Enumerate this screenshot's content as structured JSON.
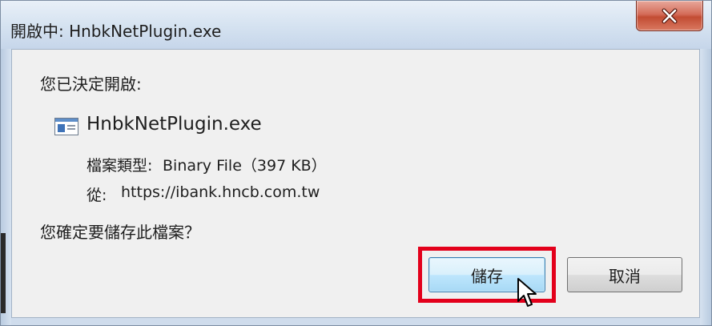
{
  "dialog": {
    "title": "開啟中: HnbkNetPlugin.exe",
    "prompt": "您已決定開啟:",
    "file": {
      "icon": "exe-file-icon",
      "name": "HnbkNetPlugin.exe",
      "type_label": "檔案類型:",
      "type_value": "Binary File（397 KB）",
      "from_label": "從:",
      "from_value": "https://ibank.hncb.com.tw"
    },
    "question": "您確定要儲存此檔案？",
    "buttons": {
      "save_label": "儲存",
      "cancel_label": "取消"
    }
  },
  "colors": {
    "highlight": "#e3001b",
    "close_button": "#c24c33",
    "default_button_border": "#3c7fb1"
  }
}
